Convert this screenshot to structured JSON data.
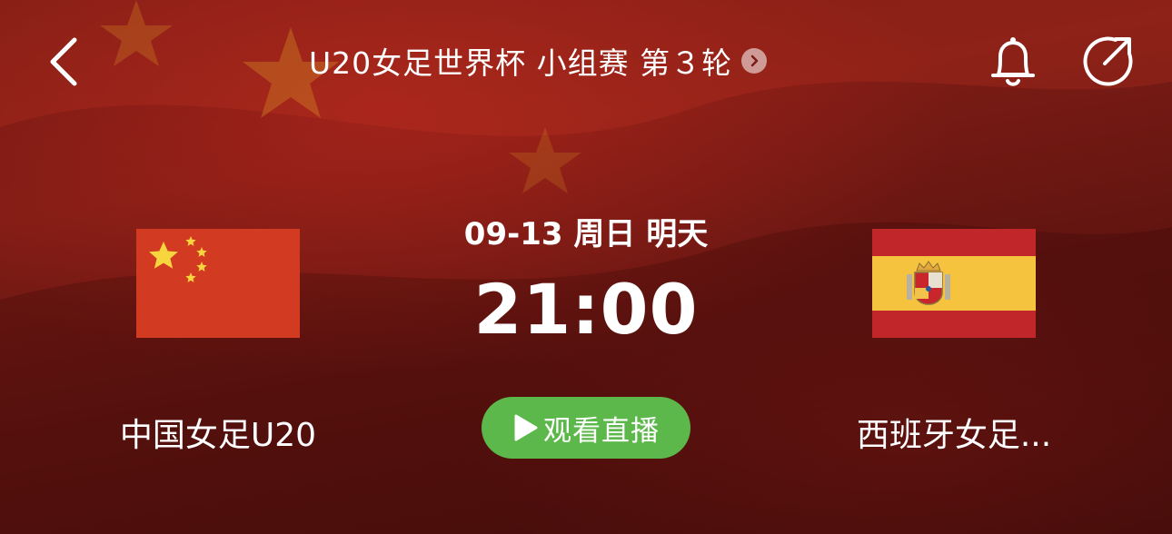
{
  "header": {
    "title": "U20女足世界杯 小组赛 第３轮",
    "back_icon": "chevron-left-icon",
    "title_icon": "chevron-right-icon",
    "notify_icon": "bell-icon",
    "share_icon": "share-icon"
  },
  "match": {
    "date": "09-13 周日 明天",
    "time": "21:00",
    "home_team": {
      "name": "中国女足U20",
      "flag": "china-flag-icon"
    },
    "away_team": {
      "name": "西班牙女足...",
      "flag": "spain-flag-icon"
    },
    "live_button": {
      "label": "观看直播",
      "icon": "play-icon"
    }
  },
  "colors": {
    "background": "#6d1712",
    "live_button": "#5cb84a",
    "china_red": "#de2910",
    "china_yellow": "#ffde00",
    "spain_red": "#c60b1e",
    "spain_yellow": "#ffc400"
  }
}
